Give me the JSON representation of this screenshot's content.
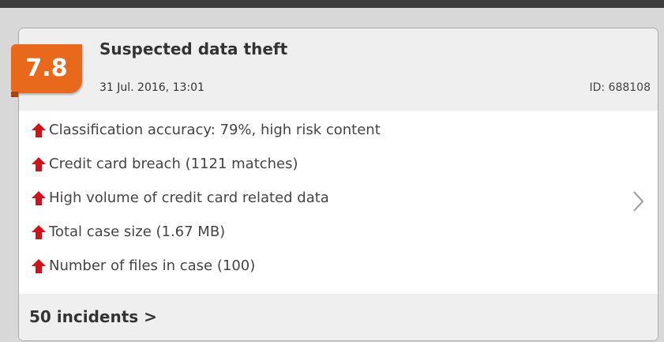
{
  "alert": {
    "score": "7.8",
    "title": "Suspected data theft",
    "date": "31 Jul. 2016, 13:01",
    "id_label": "ID: 688108",
    "reasons": [
      {
        "label": "Classification accuracy: 79%, high risk content",
        "icon": "arrow-up-icon"
      },
      {
        "label": "Credit card breach (1121 matches)",
        "icon": "arrow-up-icon"
      },
      {
        "label": "High volume of credit card related data",
        "icon": "arrow-up-icon"
      },
      {
        "label": "Total case size (1.67 MB)",
        "icon": "arrow-up-icon"
      },
      {
        "label": "Number of files in case (100)",
        "icon": "arrow-up-icon"
      }
    ],
    "incidents_link": "50 incidents >"
  },
  "colors": {
    "score_badge": "#e8691c",
    "arrow": "#d0121b",
    "header_bg": "#efefef",
    "top_bar": "#3d3d3d"
  }
}
